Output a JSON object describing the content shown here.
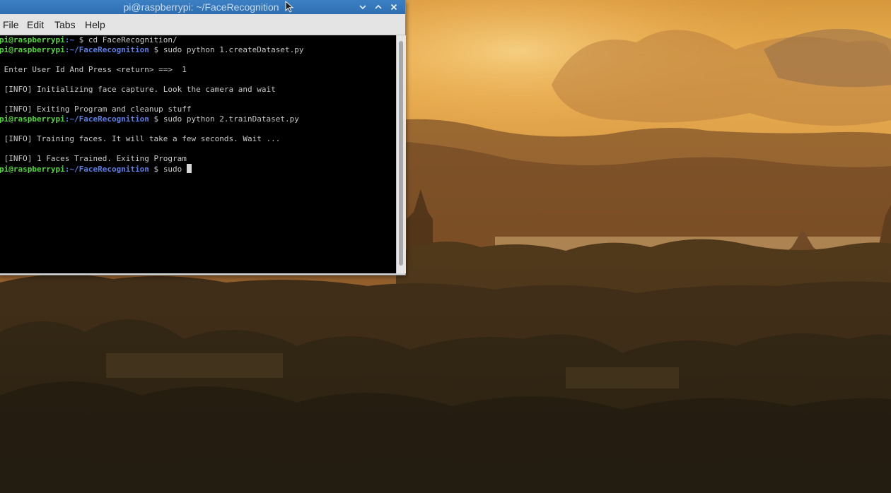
{
  "window": {
    "title": "pi@raspberrypi: ~/FaceRecognition"
  },
  "menu": {
    "items": [
      "File",
      "Edit",
      "Tabs",
      "Help"
    ]
  },
  "terminal": {
    "lines": [
      {
        "user": "pi@raspberrypi",
        "path": ":~",
        "dollar": " $ ",
        "text": "cd FaceRecognition/"
      },
      {
        "user": "pi@raspberrypi",
        "path": ":~/FaceRecognition",
        "dollar": " $ ",
        "text": "sudo python 1.createDataset.py"
      },
      {
        "text": ""
      },
      {
        "text": " Enter User Id And Press <return> ==>  1"
      },
      {
        "text": ""
      },
      {
        "text": " [INFO] Initializing face capture. Look the camera and wait"
      },
      {
        "text": ""
      },
      {
        "text": " [INFO] Exiting Program and cleanup stuff"
      },
      {
        "user": "pi@raspberrypi",
        "path": ":~/FaceRecognition",
        "dollar": " $ ",
        "text": "sudo python 2.trainDataset.py"
      },
      {
        "text": ""
      },
      {
        "text": " [INFO] Training faces. It will take a few seconds. Wait ..."
      },
      {
        "text": ""
      },
      {
        "text": " [INFO] 1 Faces Trained. Exiting Program"
      },
      {
        "user": "pi@raspberrypi",
        "path": ":~/FaceRecognition",
        "dollar": " $ ",
        "text": "sudo ",
        "cursor": true
      }
    ]
  },
  "colors": {
    "titlebar": "#2e6eb1",
    "prompt_user": "#53d43a",
    "prompt_path": "#5a7ee8",
    "terminal_bg": "#000000",
    "terminal_fg": "#c8c8c8"
  },
  "icons": {
    "titlebar_buttons": [
      "minimize-icon",
      "maximize-icon",
      "close-icon"
    ]
  }
}
